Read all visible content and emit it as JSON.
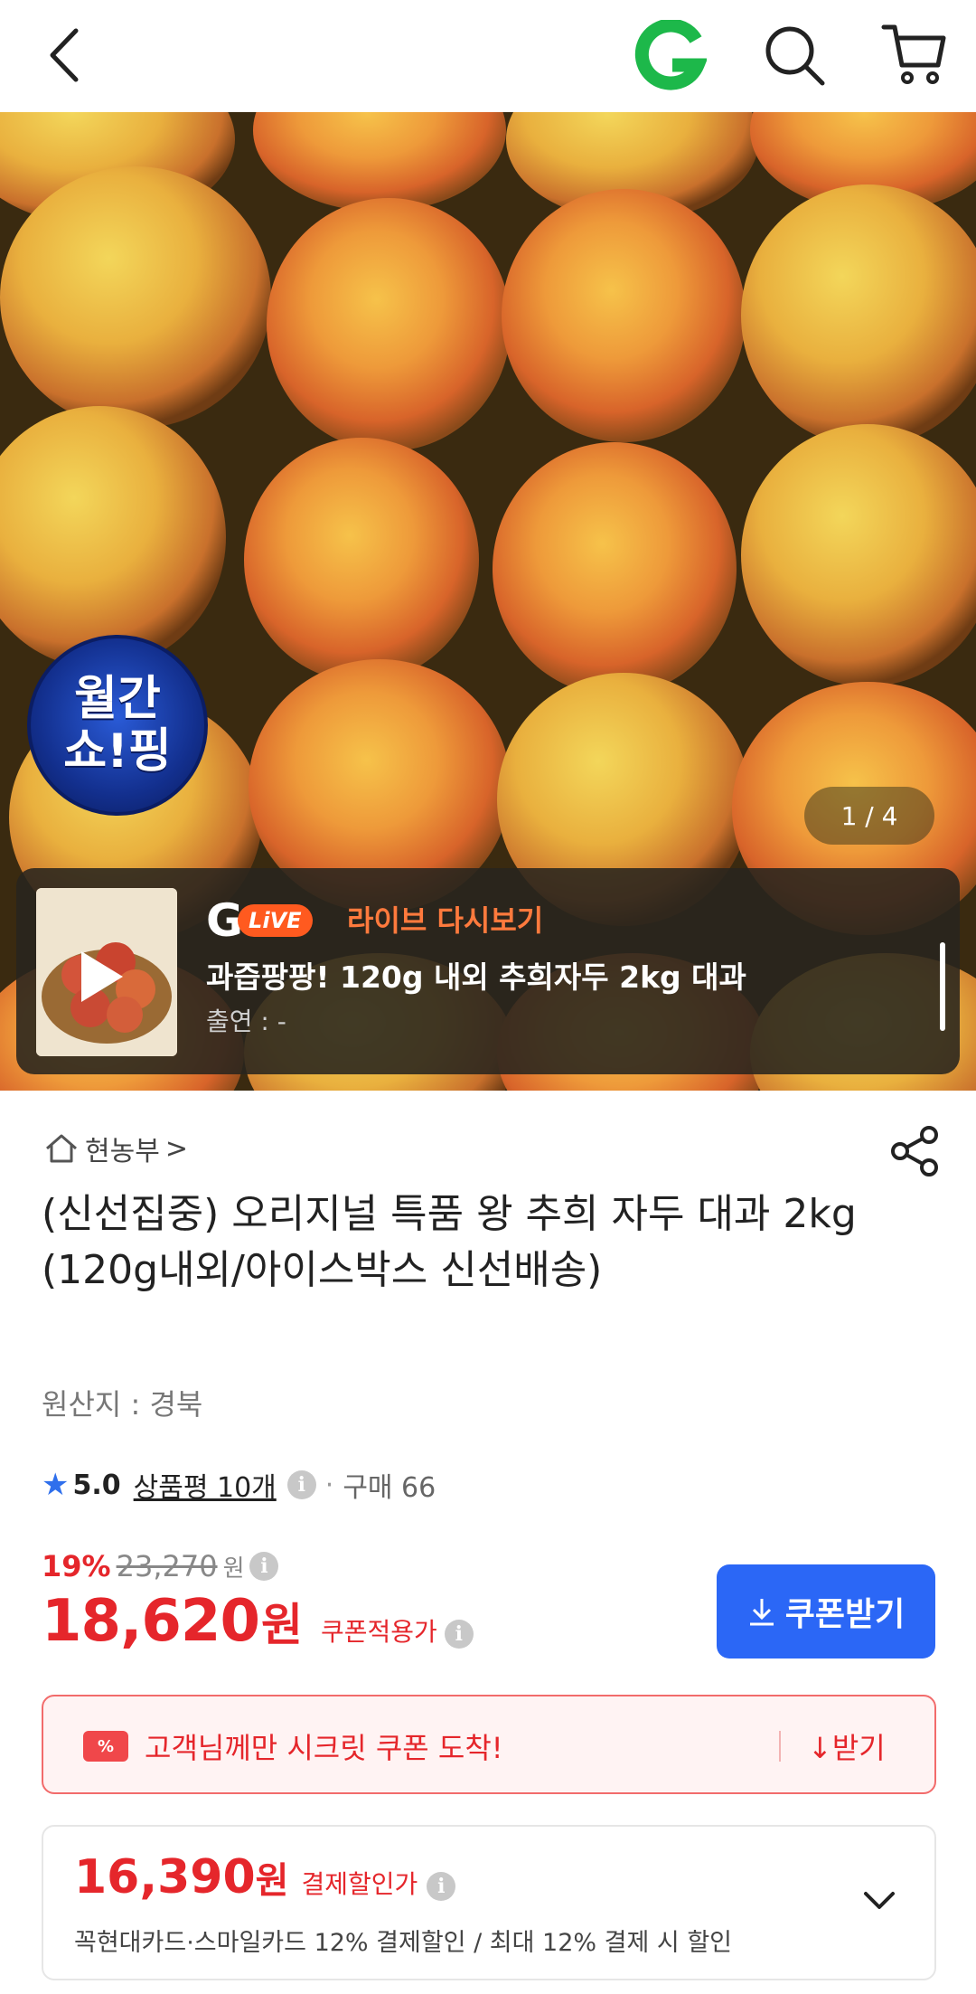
{
  "header": {
    "logo_letter": "G"
  },
  "hero": {
    "badge_line1": "월간",
    "badge_line2": "쇼!핑",
    "counter": "1 / 4",
    "live": {
      "brand_letter": "G",
      "live_pill": "LiVE",
      "replay_label": "라이브 다시보기",
      "title": "과즙팡팡! 120g 내외 추희자두 2kg 대과",
      "cast": "출연 : -"
    }
  },
  "product": {
    "store_name": "현농부",
    "store_chevron": ">",
    "title": "(신선집중) 오리지널 특품 왕 추희 자두 대과 2kg (120g내외/아이스박스 신선배송)",
    "origin": "원산지 : 경북",
    "rating": {
      "score": "5.0",
      "reviews_label": "상품평 10개",
      "purchase_label": "구매 66"
    },
    "pricing": {
      "discount_rate": "19%",
      "original_price": "23,270",
      "original_unit": "원",
      "sale_price": "18,620",
      "sale_unit": "원",
      "coupon_applied_label": "쿠폰적용가",
      "coupon_button": "쿠폰받기"
    },
    "secret_coupon": {
      "tag": "%",
      "message": "고객님께만 시크릿 쿠폰 도착!",
      "receive_label": "받기"
    },
    "card_pay": {
      "price": "16,390",
      "unit": "원",
      "label": "결제할인가",
      "detail": "꼭현대카드·스마일카드 12% 결제할인 / 최대 12% 결제 시 할인"
    }
  },
  "colors": {
    "accent_red": "#e5262b",
    "coupon_blue": "#2b67f6",
    "star_blue": "#2f6fec",
    "logo_green": "#1db84a"
  }
}
